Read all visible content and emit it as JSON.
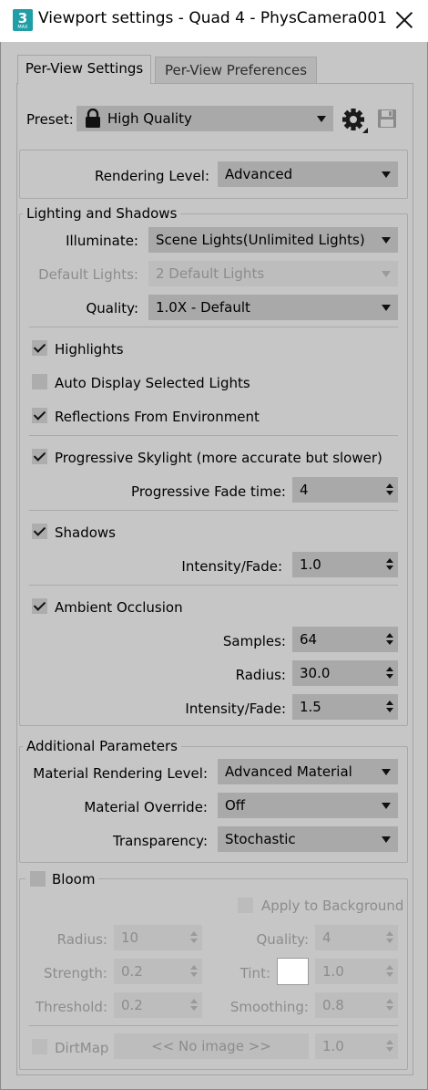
{
  "window": {
    "title": "Viewport settings - Quad 4 - PhysCamera001",
    "app_icon_text": "3",
    "app_icon_sub": "MAX",
    "close_icon": "close-icon"
  },
  "tabs": [
    {
      "label": "Per-View Settings",
      "active": true
    },
    {
      "label": "Per-View Preferences",
      "active": false
    }
  ],
  "preset": {
    "label": "Preset:",
    "value": "High Quality",
    "lock_icon": "lock-icon",
    "gear_icon": "gear-icon",
    "save_icon": "save-icon"
  },
  "rendering": {
    "label": "Rendering Level:",
    "value": "Advanced"
  },
  "lighting": {
    "group_label": "Lighting and Shadows",
    "illuminate": {
      "label": "Illuminate:",
      "value": "Scene Lights(Unlimited Lights)"
    },
    "default_lights": {
      "label": "Default Lights:",
      "value": "2 Default Lights",
      "disabled": true
    },
    "quality": {
      "label": "Quality:",
      "value": "1.0X - Default"
    },
    "highlights": {
      "label": "Highlights",
      "checked": true
    },
    "auto_display": {
      "label": "Auto Display Selected Lights",
      "checked": false
    },
    "reflections": {
      "label": "Reflections From Environment",
      "checked": true
    },
    "progressive": {
      "label": "Progressive Skylight (more accurate but slower)",
      "checked": true
    },
    "fade_time": {
      "label": "Progressive Fade time:",
      "value": "4"
    },
    "shadows": {
      "label": "Shadows",
      "checked": true
    },
    "shadow_intensity": {
      "label": "Intensity/Fade:",
      "value": "1.0"
    },
    "ao": {
      "label": "Ambient Occlusion",
      "checked": true
    },
    "samples": {
      "label": "Samples:",
      "value": "64"
    },
    "radius": {
      "label": "Radius:",
      "value": "30.0"
    },
    "ao_intensity": {
      "label": "Intensity/Fade:",
      "value": "1.5"
    }
  },
  "additional": {
    "group_label": "Additional Parameters",
    "material_level": {
      "label": "Material Rendering Level:",
      "value": "Advanced Material"
    },
    "material_override": {
      "label": "Material Override:",
      "value": "Off"
    },
    "transparency": {
      "label": "Transparency:",
      "value": "Stochastic"
    }
  },
  "bloom": {
    "label": "Bloom",
    "checked": false,
    "apply_bg": {
      "label": "Apply to Background",
      "checked": false
    },
    "radius": {
      "label": "Radius:",
      "value": "10"
    },
    "quality": {
      "label": "Quality:",
      "value": "4"
    },
    "strength": {
      "label": "Strength:",
      "value": "0.2"
    },
    "tint": {
      "label": "Tint:",
      "value": "1.0",
      "swatch_color": "#ffffff"
    },
    "threshold": {
      "label": "Threshold:",
      "value": "0.2"
    },
    "smoothing": {
      "label": "Smoothing:",
      "value": "0.8"
    },
    "dirtmap": {
      "label": "DirtMap",
      "checked": false,
      "button": "<< No image >>",
      "value": "1.0"
    }
  }
}
